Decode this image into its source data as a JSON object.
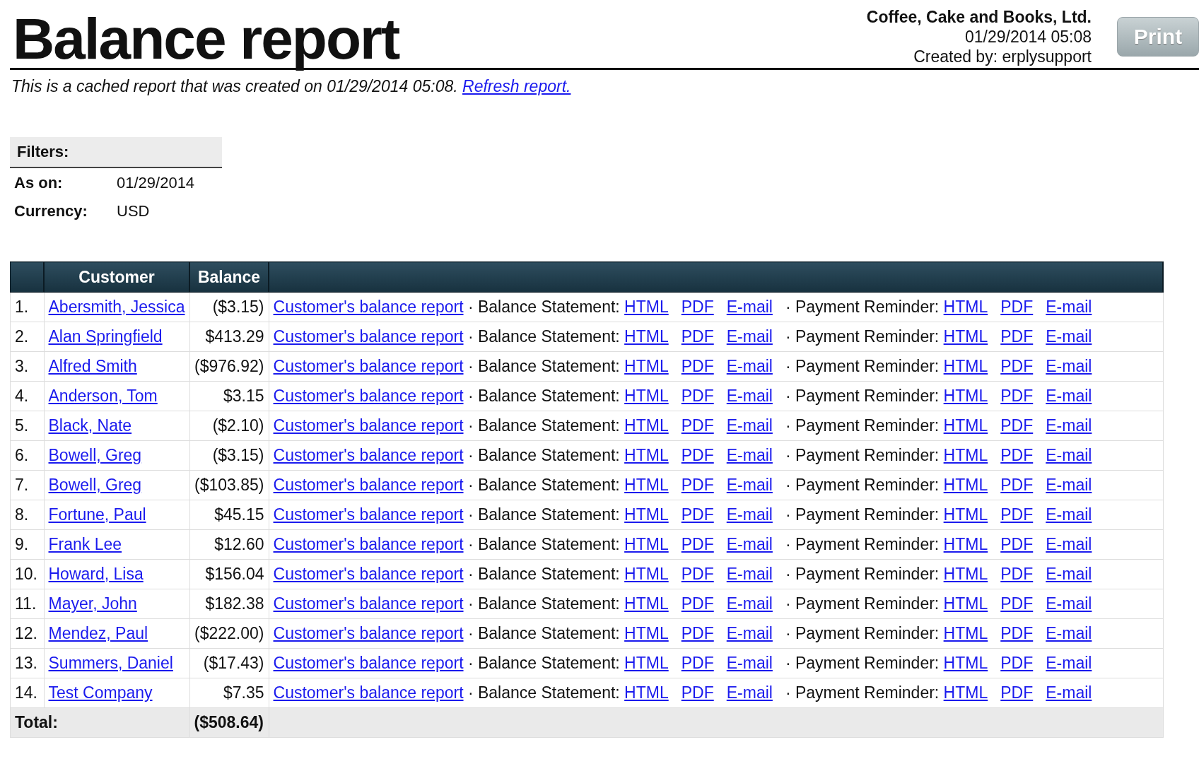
{
  "title": "Balance report",
  "company": "Coffee, Cake and Books, Ltd.",
  "generated": "01/29/2014 05:08",
  "created_by": "Created by: erplysupport",
  "print_button": "Print",
  "notice": {
    "text": "This is a cached report that was created on 01/29/2014 05:08.",
    "link": "Refresh report."
  },
  "filters": {
    "heading": "Filters:",
    "rows": [
      {
        "label": "As on:",
        "value": "01/29/2014"
      },
      {
        "label": "Currency:",
        "value": "USD"
      }
    ]
  },
  "table": {
    "columns": [
      "Customer",
      "Balance"
    ],
    "rows": [
      {
        "number": "1.",
        "customer": "Abersmith, Jessica",
        "balance": "($3.15)",
        "report": "Customer's balance report",
        "sep1": "·",
        "statement_label": "Balance Statement:",
        "statement_links": [
          "HTML",
          "PDF",
          "E-mail"
        ],
        "sep2": "·",
        "reminder_label": "Payment Reminder:",
        "reminder_links": [
          "HTML",
          "PDF",
          "E-mail"
        ]
      },
      {
        "number": "2.",
        "customer": "Alan Springfield",
        "balance": "$413.29",
        "report": "Customer's balance report",
        "sep1": "·",
        "statement_label": "Balance Statement:",
        "statement_links": [
          "HTML",
          "PDF",
          "E-mail"
        ],
        "sep2": "·",
        "reminder_label": "Payment Reminder:",
        "reminder_links": [
          "HTML",
          "PDF",
          "E-mail"
        ]
      },
      {
        "number": "3.",
        "customer": "Alfred Smith",
        "balance": "($976.92)",
        "report": "Customer's balance report",
        "sep1": "·",
        "statement_label": "Balance Statement:",
        "statement_links": [
          "HTML",
          "PDF",
          "E-mail"
        ],
        "sep2": "·",
        "reminder_label": "Payment Reminder:",
        "reminder_links": [
          "HTML",
          "PDF",
          "E-mail"
        ]
      },
      {
        "number": "4.",
        "customer": "Anderson, Tom",
        "balance": "$3.15",
        "report": "Customer's balance report",
        "sep1": "·",
        "statement_label": "Balance Statement:",
        "statement_links": [
          "HTML",
          "PDF",
          "E-mail"
        ],
        "sep2": "·",
        "reminder_label": "Payment Reminder:",
        "reminder_links": [
          "HTML",
          "PDF",
          "E-mail"
        ]
      },
      {
        "number": "5.",
        "customer": "Black, Nate",
        "balance": "($2.10)",
        "report": "Customer's balance report",
        "sep1": "·",
        "statement_label": "Balance Statement:",
        "statement_links": [
          "HTML",
          "PDF",
          "E-mail"
        ],
        "sep2": "·",
        "reminder_label": "Payment Reminder:",
        "reminder_links": [
          "HTML",
          "PDF",
          "E-mail"
        ]
      },
      {
        "number": "6.",
        "customer": "Bowell, Greg",
        "balance": "($3.15)",
        "report": "Customer's balance report",
        "sep1": "·",
        "statement_label": "Balance Statement:",
        "statement_links": [
          "HTML",
          "PDF",
          "E-mail"
        ],
        "sep2": "·",
        "reminder_label": "Payment Reminder:",
        "reminder_links": [
          "HTML",
          "PDF",
          "E-mail"
        ]
      },
      {
        "number": "7.",
        "customer": "Bowell, Greg",
        "balance": "($103.85)",
        "report": "Customer's balance report",
        "sep1": "·",
        "statement_label": "Balance Statement:",
        "statement_links": [
          "HTML",
          "PDF",
          "E-mail"
        ],
        "sep2": "·",
        "reminder_label": "Payment Reminder:",
        "reminder_links": [
          "HTML",
          "PDF",
          "E-mail"
        ]
      },
      {
        "number": "8.",
        "customer": "Fortune, Paul",
        "balance": "$45.15",
        "report": "Customer's balance report",
        "sep1": "·",
        "statement_label": "Balance Statement:",
        "statement_links": [
          "HTML",
          "PDF",
          "E-mail"
        ],
        "sep2": "·",
        "reminder_label": "Payment Reminder:",
        "reminder_links": [
          "HTML",
          "PDF",
          "E-mail"
        ]
      },
      {
        "number": "9.",
        "customer": "Frank Lee",
        "balance": "$12.60",
        "report": "Customer's balance report",
        "sep1": "·",
        "statement_label": "Balance Statement:",
        "statement_links": [
          "HTML",
          "PDF",
          "E-mail"
        ],
        "sep2": "·",
        "reminder_label": "Payment Reminder:",
        "reminder_links": [
          "HTML",
          "PDF",
          "E-mail"
        ]
      },
      {
        "number": "10.",
        "customer": "Howard, Lisa",
        "balance": "$156.04",
        "report": "Customer's balance report",
        "sep1": "·",
        "statement_label": "Balance Statement:",
        "statement_links": [
          "HTML",
          "PDF",
          "E-mail"
        ],
        "sep2": "·",
        "reminder_label": "Payment Reminder:",
        "reminder_links": [
          "HTML",
          "PDF",
          "E-mail"
        ]
      },
      {
        "number": "11.",
        "customer": "Mayer, John",
        "balance": "$182.38",
        "report": "Customer's balance report",
        "sep1": "·",
        "statement_label": "Balance Statement:",
        "statement_links": [
          "HTML",
          "PDF",
          "E-mail"
        ],
        "sep2": "·",
        "reminder_label": "Payment Reminder:",
        "reminder_links": [
          "HTML",
          "PDF",
          "E-mail"
        ]
      },
      {
        "number": "12.",
        "customer": "Mendez, Paul",
        "balance": "($222.00)",
        "report": "Customer's balance report",
        "sep1": "·",
        "statement_label": "Balance Statement:",
        "statement_links": [
          "HTML",
          "PDF",
          "E-mail"
        ],
        "sep2": "·",
        "reminder_label": "Payment Reminder:",
        "reminder_links": [
          "HTML",
          "PDF",
          "E-mail"
        ]
      },
      {
        "number": "13.",
        "customer": "Summers, Daniel",
        "balance": "($17.43)",
        "report": "Customer's balance report",
        "sep1": "·",
        "statement_label": "Balance Statement:",
        "statement_links": [
          "HTML",
          "PDF",
          "E-mail"
        ],
        "sep2": "·",
        "reminder_label": "Payment Reminder:",
        "reminder_links": [
          "HTML",
          "PDF",
          "E-mail"
        ]
      },
      {
        "number": "14.",
        "customer": "Test Company",
        "balance": "$7.35",
        "report": "Customer's balance report",
        "sep1": "·",
        "statement_label": "Balance Statement:",
        "statement_links": [
          "HTML",
          "PDF",
          "E-mail"
        ],
        "sep2": "·",
        "reminder_label": "Payment Reminder:",
        "reminder_links": [
          "HTML",
          "PDF",
          "E-mail"
        ]
      }
    ],
    "total": {
      "label": "Total:",
      "balance": "($508.64)"
    }
  }
}
